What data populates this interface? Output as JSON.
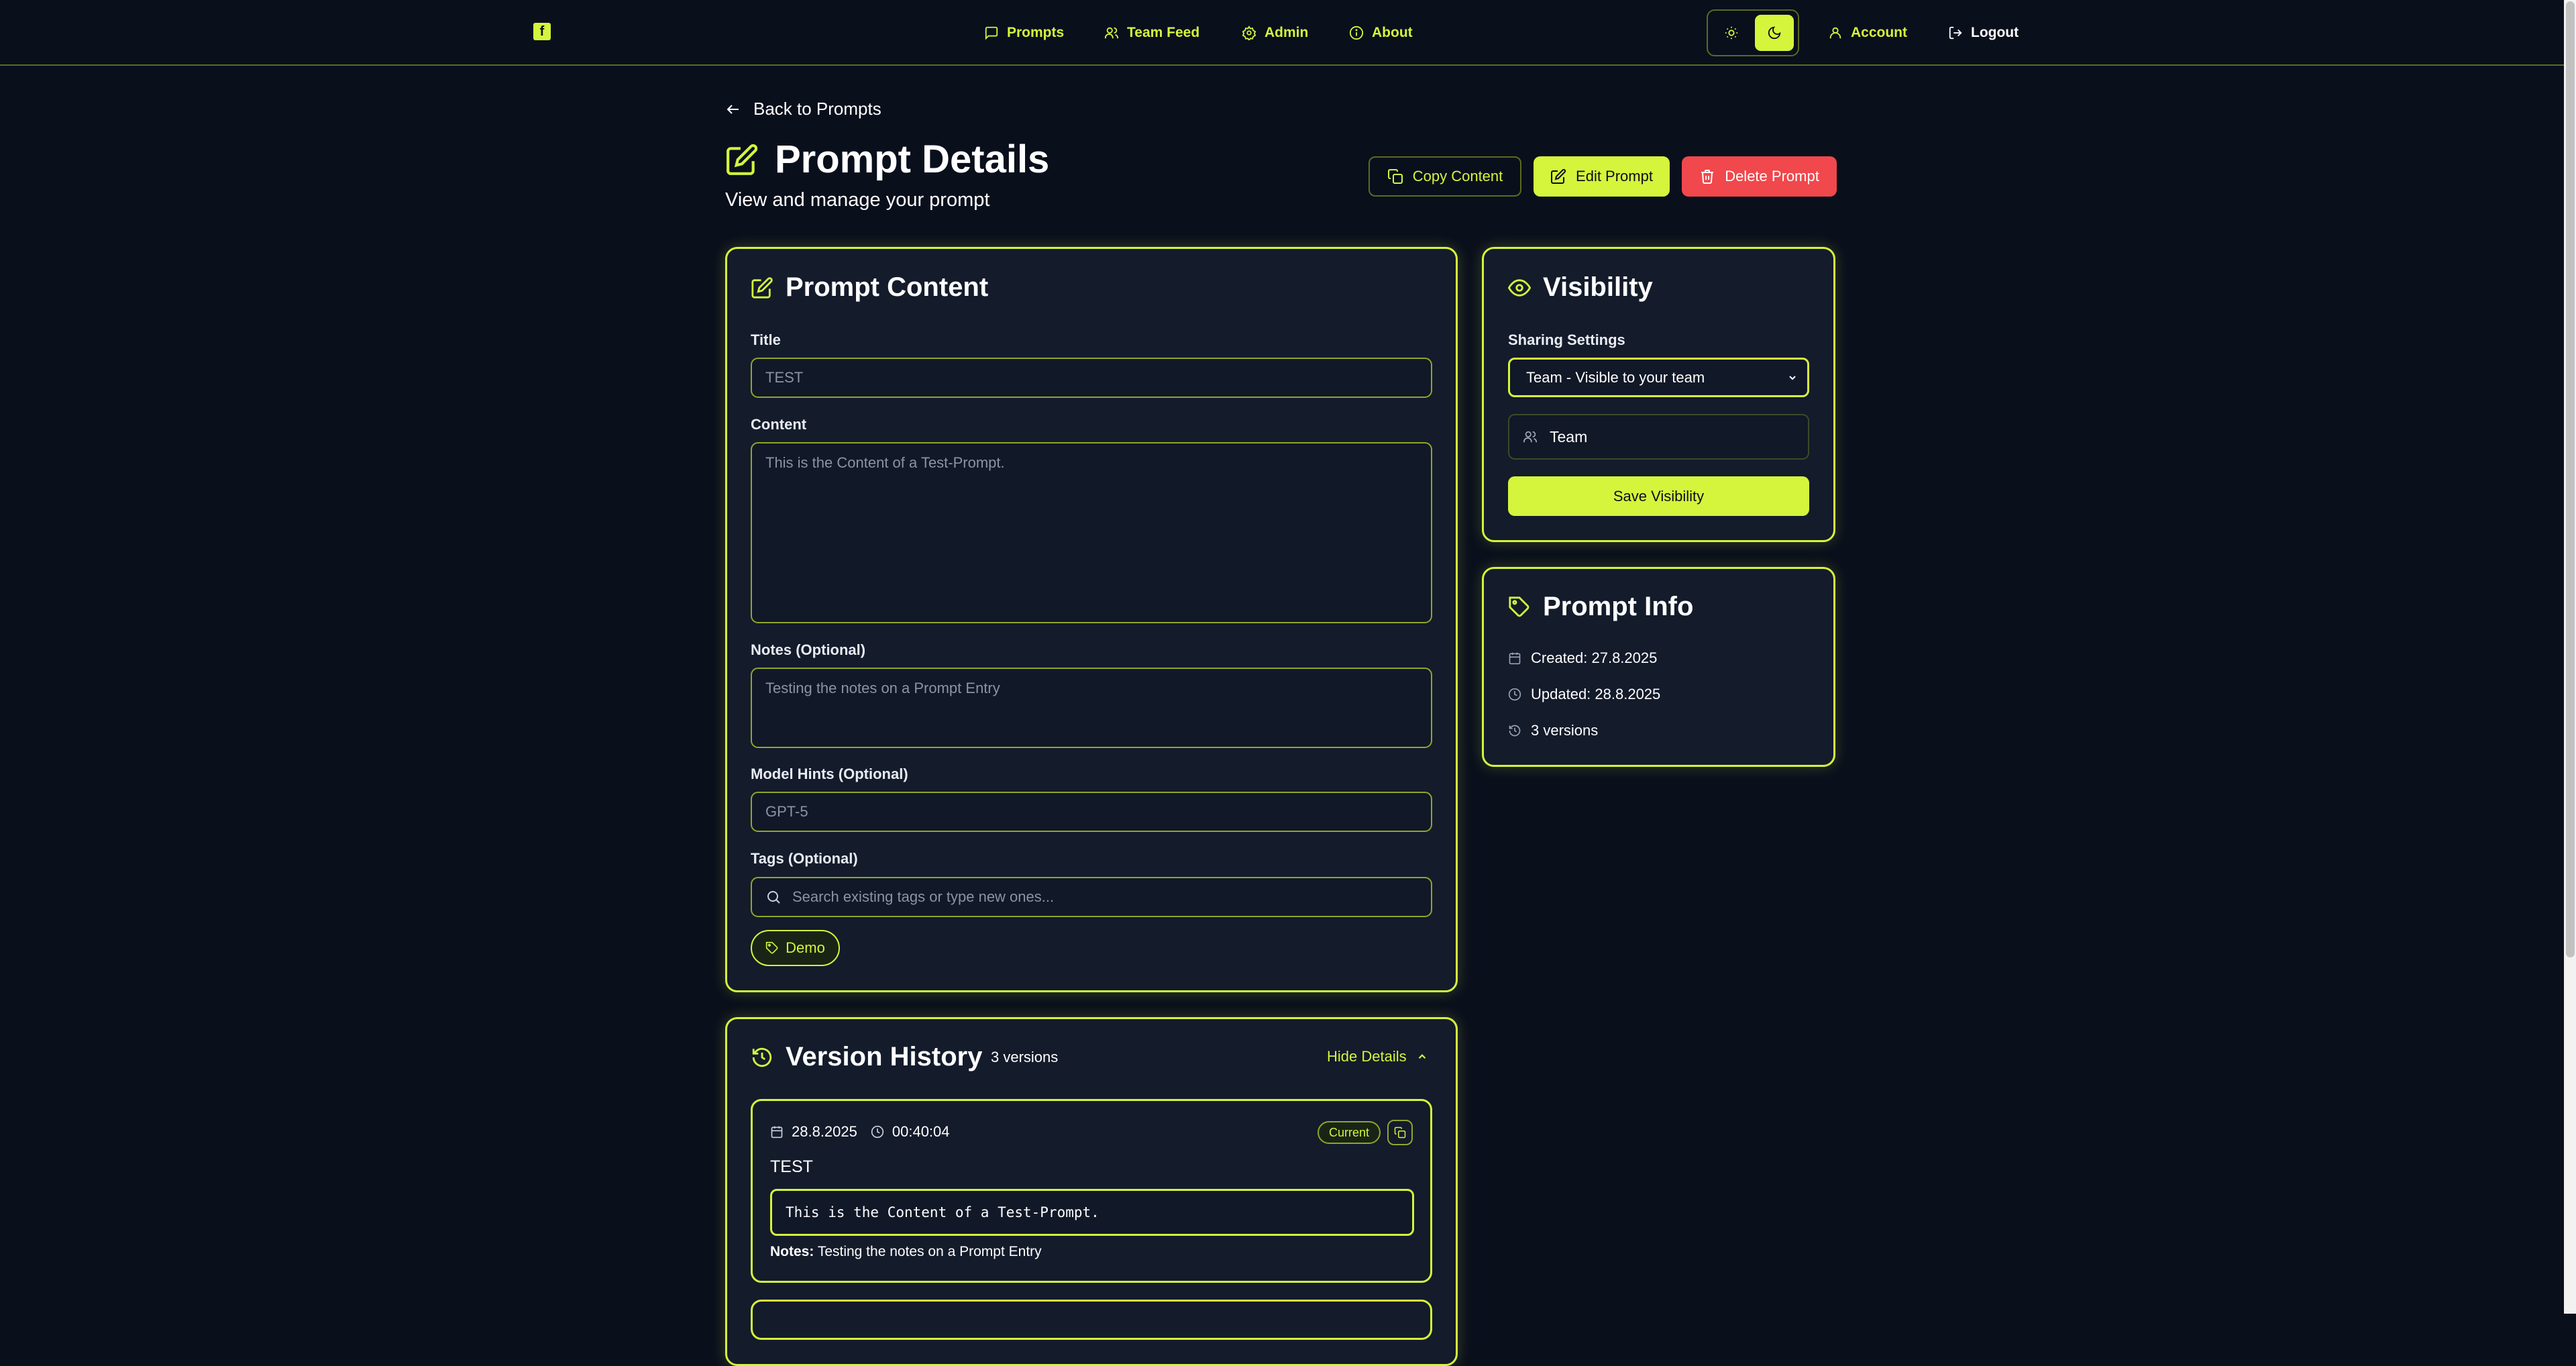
{
  "nav": {
    "logo": "f",
    "links": [
      {
        "label": "Prompts",
        "icon": "message-square-icon"
      },
      {
        "label": "Team Feed",
        "icon": "users-icon"
      },
      {
        "label": "Admin",
        "icon": "settings-icon"
      },
      {
        "label": "About",
        "icon": "info-icon"
      }
    ],
    "account": "Account",
    "logout": "Logout"
  },
  "header": {
    "back": "Back to Prompts",
    "title": "Prompt Details",
    "subtitle": "View and manage your prompt",
    "copy_label": "Copy Content",
    "edit_label": "Edit Prompt",
    "delete_label": "Delete Prompt"
  },
  "content_card": {
    "title": "Prompt Content",
    "title_label": "Title",
    "title_value": "TEST",
    "content_label": "Content",
    "content_value": "This is the Content of a Test-Prompt.",
    "notes_label": "Notes (Optional)",
    "notes_value": "Testing the notes on a Prompt Entry",
    "model_label": "Model Hints (Optional)",
    "model_value": "GPT-5",
    "tags_label": "Tags (Optional)",
    "tags_placeholder": "Search existing tags or type new ones...",
    "tags": [
      "Demo"
    ]
  },
  "visibility": {
    "title": "Visibility",
    "sharing_label": "Sharing Settings",
    "selected": "Team - Visible to your team",
    "current": "Team",
    "save_label": "Save Visibility"
  },
  "info": {
    "title": "Prompt Info",
    "created": "Created: 27.8.2025",
    "updated": "Updated: 28.8.2025",
    "versions": "3 versions"
  },
  "history": {
    "title": "Version History",
    "count": "3 versions",
    "toggle": "Hide Details",
    "entries": [
      {
        "date": "28.8.2025",
        "time": "00:40:04",
        "badge": "Current",
        "title": "TEST",
        "content": "This is the Content of a Test-Prompt.",
        "notes_label": "Notes:",
        "notes": "Testing the notes on a Prompt Entry"
      }
    ]
  },
  "colors": {
    "background": "#0a0f1c",
    "card": "#141b2b",
    "accent": "#d4f53c",
    "danger": "#f0484c"
  }
}
